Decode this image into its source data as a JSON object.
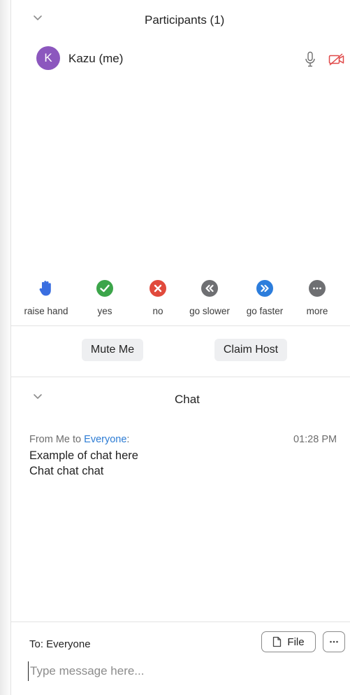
{
  "participants": {
    "title": "Participants (1)",
    "list": [
      {
        "initial": "K",
        "name": "Kazu (me)",
        "avatar_color": "#8c57be"
      }
    ]
  },
  "reactions": [
    {
      "label": "raise hand",
      "icon": "raise-hand-icon",
      "color": "#3a6ee0"
    },
    {
      "label": "yes",
      "icon": "check-icon",
      "color": "#3ca54a"
    },
    {
      "label": "no",
      "icon": "x-icon",
      "color": "#e14a3c"
    },
    {
      "label": "go slower",
      "icon": "rewind-icon",
      "color": "#6e6f72"
    },
    {
      "label": "go faster",
      "icon": "fast-forward-icon",
      "color": "#2c7ddc"
    },
    {
      "label": "more",
      "icon": "ellipsis-icon",
      "color": "#6e6f72"
    }
  ],
  "buttons": {
    "mute": "Mute Me",
    "claim": "Claim Host"
  },
  "chat": {
    "title": "Chat",
    "message": {
      "from_prefix": "From Me to ",
      "recipient": "Everyone",
      "suffix": ":",
      "time": "01:28 PM",
      "lines": [
        "Example of chat here",
        "Chat chat chat"
      ]
    },
    "to_label": "To: Everyone",
    "file_label": "File",
    "placeholder": "Type message here..."
  },
  "colors": {
    "link": "#2d7cd4",
    "video_off": "#e04848"
  }
}
